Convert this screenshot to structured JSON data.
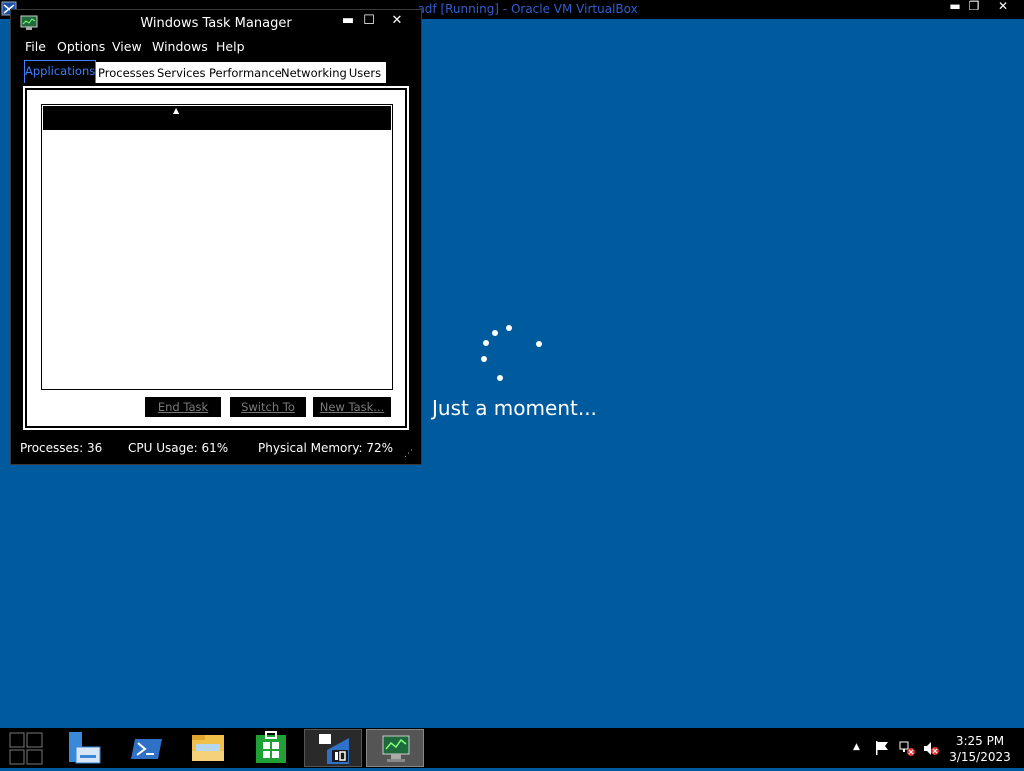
{
  "host": {
    "title": "...adf [Running] - Oracle VM VirtualBox",
    "icon": "virtualbox-icon",
    "controls": [
      "minimize-icon",
      "restore-icon",
      "close-icon"
    ]
  },
  "task_manager": {
    "title": "Windows Task Manager",
    "icon": "task-manager-icon",
    "menu": [
      "File",
      "Options",
      "View",
      "Windows",
      "Help"
    ],
    "tabs": [
      "Applications",
      "Processes",
      "Services",
      "Performance",
      "Networking",
      "Users"
    ],
    "active_tab": "Applications",
    "list": {
      "sort_indicator": "▲",
      "rows": []
    },
    "buttons": {
      "end_task": "End Task",
      "switch_to": "Switch To",
      "new_task": "New Task..."
    },
    "status": {
      "processes": "Processes: 36",
      "cpu": "CPU Usage: 61%",
      "memory": "Physical Memory: 72%"
    }
  },
  "loading": {
    "text": "Just a moment..."
  },
  "taskbar": {
    "apps": [
      "start-icon",
      "server-manager-icon",
      "powershell-icon",
      "file-explorer-icon",
      "store-icon",
      "windows-10-setup-icon",
      "task-manager-icon"
    ],
    "clock": {
      "time": "3:25 PM",
      "date": "3/15/2023"
    },
    "tray": [
      "show-hidden-icons-icon",
      "action-center-flag-icon",
      "network-error-icon",
      "volume-muted-icon"
    ]
  },
  "colors": {
    "desktop": "#005a9e",
    "accent_blue": "#3d7fff"
  }
}
